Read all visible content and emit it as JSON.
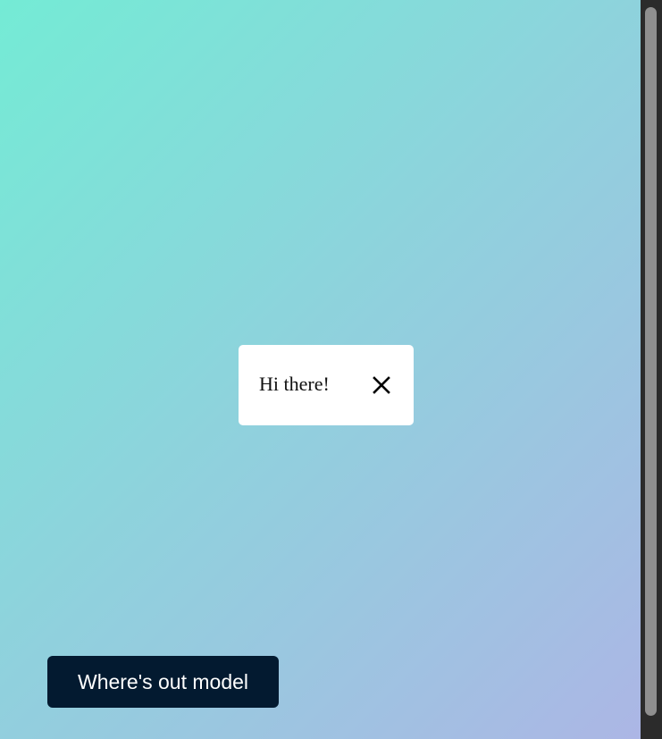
{
  "popup": {
    "message": "Hi there!",
    "close_icon": "close-icon"
  },
  "cta": {
    "label": "Where's out model"
  },
  "colors": {
    "gradient_start": "#74ebd5",
    "gradient_end": "#acb6e5",
    "button_bg": "#031a30",
    "popup_bg": "#ffffff",
    "scrollbar_track": "#2b2b2b",
    "scrollbar_thumb": "#8f8f8f"
  }
}
